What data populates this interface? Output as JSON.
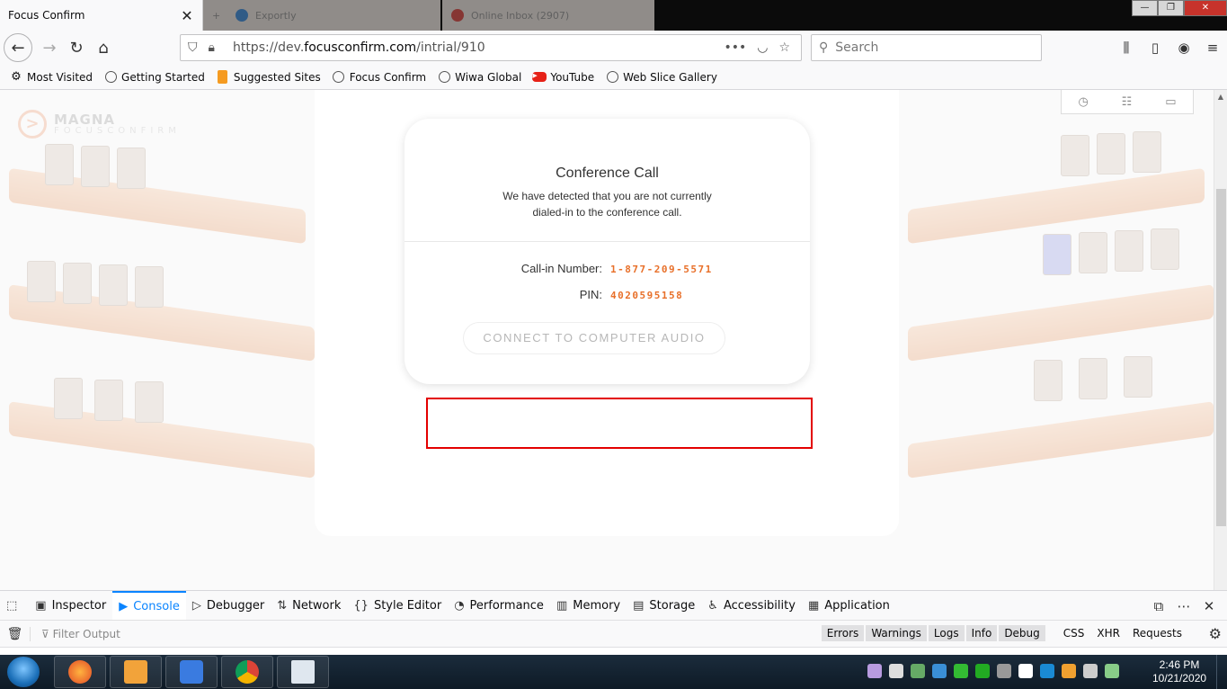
{
  "browser": {
    "active_tab_title": "Focus Confirm",
    "other_tabs": [
      "Exportly",
      "Online Inbox (2907)"
    ],
    "url_prefix": "https://dev.",
    "url_domain": "focusconfirm.com",
    "url_path": "/intrial/910",
    "search_placeholder": "Search",
    "bookmarks": [
      {
        "label": "Most Visited",
        "icon": "gear-icon"
      },
      {
        "label": "Getting Started",
        "icon": "globe-icon"
      },
      {
        "label": "Suggested Sites",
        "icon": "ie-icon"
      },
      {
        "label": "Focus Confirm",
        "icon": "globe-icon"
      },
      {
        "label": "Wiwa Global",
        "icon": "globe-icon"
      },
      {
        "label": "YouTube",
        "icon": "youtube-icon"
      },
      {
        "label": "Web Slice Gallery",
        "icon": "globe-icon"
      }
    ]
  },
  "page": {
    "logo_line1": "MAGNA",
    "logo_line2": "FOCUSCONFIRM"
  },
  "modal": {
    "title": "Conference Call",
    "message": "We have detected that you are not currently dialed-in to the conference call.",
    "callin_label": "Call-in Number:",
    "callin_value": "1-877-209-5571",
    "pin_label": "PIN:",
    "pin_value": "4020595158",
    "connect_button": "CONNECT TO COMPUTER AUDIO"
  },
  "devtools": {
    "tabs": [
      {
        "label": "Inspector",
        "icon": "inspector-icon"
      },
      {
        "label": "Console",
        "icon": "console-icon",
        "active": true
      },
      {
        "label": "Debugger",
        "icon": "debugger-icon"
      },
      {
        "label": "Network",
        "icon": "network-icon"
      },
      {
        "label": "Style Editor",
        "icon": "style-editor-icon"
      },
      {
        "label": "Performance",
        "icon": "performance-icon"
      },
      {
        "label": "Memory",
        "icon": "memory-icon"
      },
      {
        "label": "Storage",
        "icon": "storage-icon"
      },
      {
        "label": "Accessibility",
        "icon": "accessibility-icon"
      },
      {
        "label": "Application",
        "icon": "application-icon"
      }
    ],
    "filter_placeholder": "Filter Output",
    "filter_buttons": [
      "Errors",
      "Warnings",
      "Logs",
      "Info",
      "Debug"
    ],
    "extra_filters": [
      "CSS",
      "XHR",
      "Requests"
    ]
  },
  "taskbar": {
    "time": "2:46 PM",
    "date": "10/21/2020"
  },
  "colors": {
    "accent": "#e8702a",
    "highlight": "#e30000",
    "devtools_active": "#0a84ff"
  }
}
